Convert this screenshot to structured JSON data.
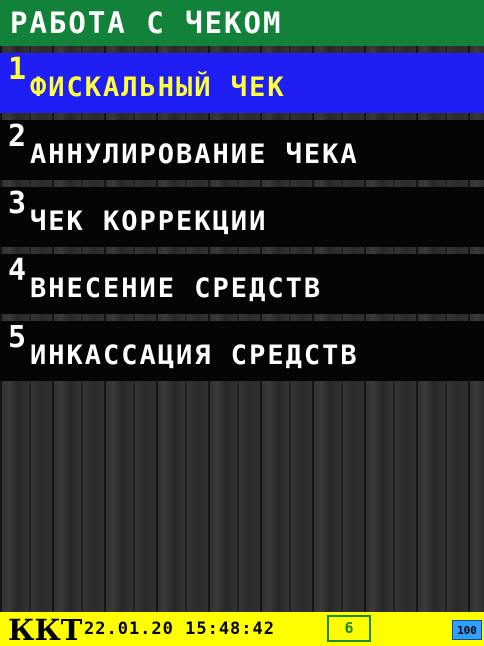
{
  "header": {
    "title": "РАБОТА С ЧЕКОМ"
  },
  "menu": {
    "items": [
      {
        "number": "1",
        "label": "ФИСКАЛЬНЫЙ ЧЕК",
        "selected": true
      },
      {
        "number": "2",
        "label": "АННУЛИРОВАНИЕ ЧЕКА",
        "selected": false
      },
      {
        "number": "3",
        "label": "ЧЕК КОРРЕКЦИИ",
        "selected": false
      },
      {
        "number": "4",
        "label": "ВНЕСЕНИЕ СРЕДСТВ",
        "selected": false
      },
      {
        "number": "5",
        "label": "ИНКАССАЦИЯ СРЕДСТВ",
        "selected": false
      }
    ]
  },
  "status": {
    "device": "ККТ",
    "datetime": "22.01.20 15:48:42",
    "counter": "6",
    "battery": "100"
  },
  "colors": {
    "header_bg": "#12813a",
    "selected_bg": "#1f1ff5",
    "selected_text": "#ffff3a",
    "status_bg": "#ffff00",
    "badge_color": "#1a8a30",
    "battery_color": "#2fa0ff"
  }
}
